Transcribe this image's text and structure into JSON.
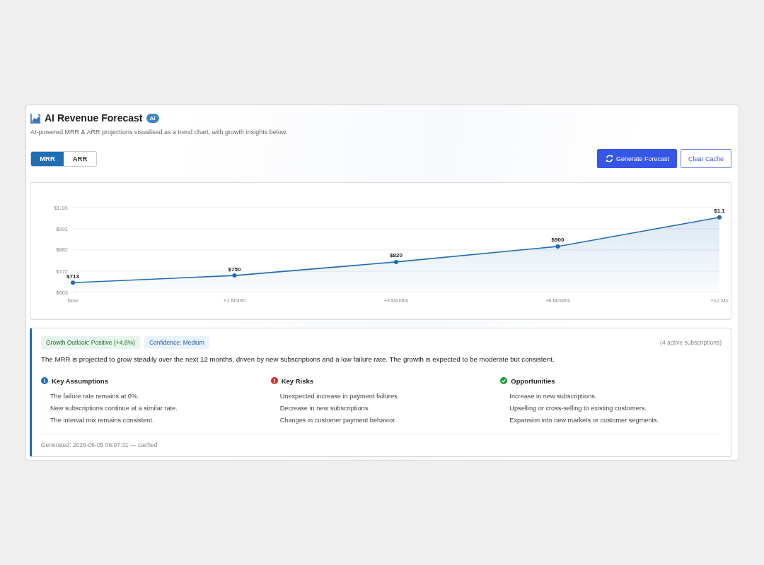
{
  "header": {
    "title": "AI Revenue Forecast",
    "badge": "AI",
    "subtitle": "AI-powered MRR & ARR projections visualised as a trend chart, with growth insights below."
  },
  "metric_tabs": [
    {
      "label": "MRR",
      "selected": true
    },
    {
      "label": "ARR",
      "selected": false
    }
  ],
  "actions": [
    {
      "label": "Generate Forecast",
      "kind": "primary"
    },
    {
      "label": "Clear Cache",
      "kind": "outline"
    }
  ],
  "chart": {
    "chart_data": {
      "type": "area",
      "categories": [
        "Now",
        "+1 Month",
        "+3 Months",
        "+6 Months",
        "+12 Mo"
      ],
      "series": [
        {
          "color": "#1f6db5",
          "values": [
            713,
            750,
            820,
            900,
            1050
          ]
        }
      ],
      "ylim": [
        663,
        1100
      ],
      "yticks": [
        {
          "value": 663,
          "label": "$663"
        },
        {
          "value": 772,
          "label": "$772"
        },
        {
          "value": 882,
          "label": "$882"
        },
        {
          "value": 991,
          "label": "$991"
        },
        {
          "value": 1100,
          "label": "$1.1K"
        }
      ],
      "grid": true,
      "value_labels": [
        "$713",
        "$750",
        "$820",
        "$900",
        "$1.1"
      ]
    }
  },
  "insights": {
    "tags": [
      {
        "label": "Growth Outlook: Positive (+4.8%)",
        "kind": "success"
      },
      {
        "label": "Confidence: Medium",
        "kind": "info"
      }
    ],
    "note": "(4 active subscriptions)",
    "summary": "The MRR is projected to grow steadily over the next 12 months, driven by new subscriptions and a low failure rate. The growth is expected to be moderate but consistent.",
    "sections": [
      {
        "kind": "info",
        "title": "Key Assumptions",
        "items": [
          "The failure rate remains at 0%.",
          "New subscriptions continue at a similar rate.",
          "The interval mix remains consistent."
        ]
      },
      {
        "kind": "risk",
        "title": "Key Risks",
        "items": [
          "Unexpected increase in payment failures.",
          "Decrease in new subscriptions.",
          "Changes in customer payment behavior."
        ]
      },
      {
        "kind": "success",
        "title": "Opportunities",
        "items": [
          "Increase in new subscriptions.",
          "Upselling or cross-selling to existing customers.",
          "Expansion into new markets or customer segments."
        ]
      }
    ],
    "footer": "Generated: 2026-06-05 06:07:31 — cached"
  }
}
